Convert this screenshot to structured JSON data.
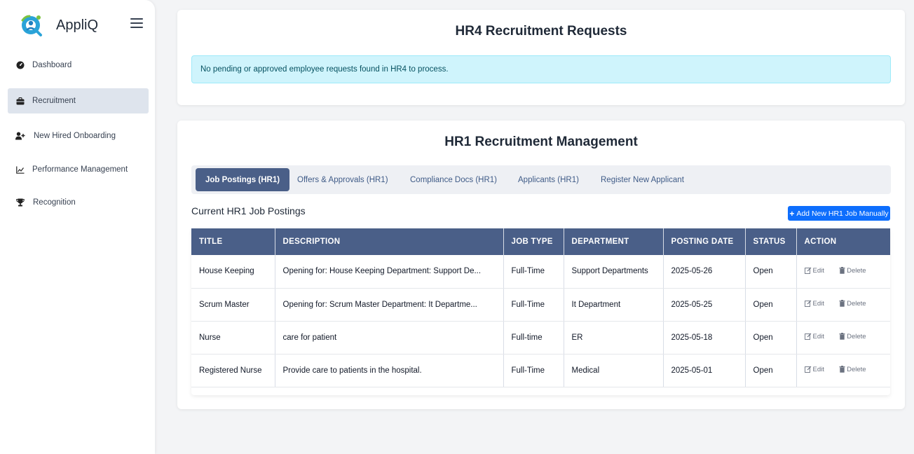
{
  "app": {
    "name": "AppliQ"
  },
  "sidebar": {
    "items": [
      {
        "label": "Dashboard",
        "icon": "gauge-icon",
        "active": false
      },
      {
        "label": "Recruitment",
        "icon": "briefcase-icon",
        "active": true
      },
      {
        "label": "New Hired Onboarding",
        "icon": "user-plus-icon",
        "active": false
      },
      {
        "label": "Performance Management",
        "icon": "line-chart-icon",
        "active": false
      },
      {
        "label": "Recognition",
        "icon": "trophy-icon",
        "active": false
      }
    ]
  },
  "hr4": {
    "title": "HR4 Recruitment Requests",
    "alert": "No pending or approved employee requests found in HR4 to process."
  },
  "hr1": {
    "title": "HR1 Recruitment Management",
    "tabs": [
      {
        "label": "Job Postings (HR1)",
        "active": true
      },
      {
        "label": "Offers & Approvals (HR1)",
        "active": false
      },
      {
        "label": "Compliance Docs (HR1)",
        "active": false
      },
      {
        "label": "Applicants (HR1)",
        "active": false
      },
      {
        "label": "Register New Applicant",
        "active": false
      }
    ],
    "section_title": "Current HR1 Job Postings",
    "add_button": "Add New HR1 Job Manually",
    "columns": [
      "TITLE",
      "DESCRIPTION",
      "JOB TYPE",
      "DEPARTMENT",
      "POSTING DATE",
      "STATUS",
      "ACTION"
    ],
    "rows": [
      {
        "title": "House Keeping",
        "description": "Opening for: House Keeping Department: Support De...",
        "job_type": "Full-Time",
        "department": "Support Departments",
        "posting_date": "2025-05-26",
        "status": "Open"
      },
      {
        "title": "Scrum Master",
        "description": "Opening for: Scrum Master Department: It Departme...",
        "job_type": "Full-Time",
        "department": "It Department",
        "posting_date": "2025-05-25",
        "status": "Open"
      },
      {
        "title": "Nurse",
        "description": "care for patient",
        "job_type": "Full-time",
        "department": "ER",
        "posting_date": "2025-05-18",
        "status": "Open"
      },
      {
        "title": "Registered Nurse",
        "description": "Provide care to patients in the hospital.",
        "job_type": "Full-Time",
        "department": "Medical",
        "posting_date": "2025-05-01",
        "status": "Open"
      }
    ],
    "actions": {
      "edit": "Edit",
      "delete": "Delete"
    }
  },
  "colors": {
    "accent": "#4a5f88",
    "primary_button": "#0d6efd",
    "alert_bg": "#cff4fc",
    "active_nav": "#dee4ed"
  }
}
